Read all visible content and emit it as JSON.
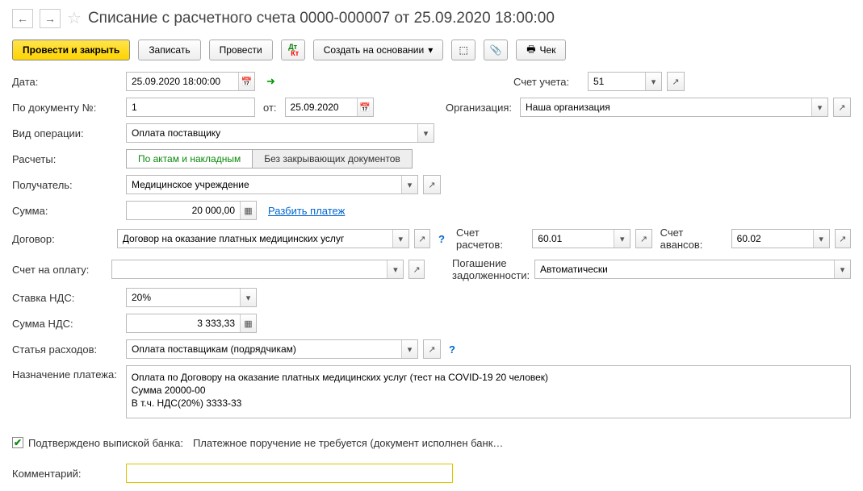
{
  "title": "Списание с расчетного счета 0000-000007 от 25.09.2020 18:00:00",
  "toolbar": {
    "post_close": "Провести и закрыть",
    "save": "Записать",
    "post": "Провести",
    "create_based": "Создать на основании",
    "check": "Чек"
  },
  "labels": {
    "date": "Дата:",
    "doc_no": "По документу №:",
    "from": "от:",
    "op_type": "Вид операции:",
    "calcs": "Расчеты:",
    "recipient": "Получатель:",
    "amount": "Сумма:",
    "split": "Разбить платеж",
    "contract": "Договор:",
    "invoice": "Счет на оплату:",
    "vat_rate": "Ставка НДС:",
    "vat_amount": "Сумма НДС:",
    "cost_item": "Статья расходов:",
    "purpose": "Назначение платежа:",
    "confirmed": "Подтверждено выпиской банка:",
    "confirmed_text": "Платежное поручение не требуется (документ исполнен банк…",
    "comment": "Комментарий:",
    "account": "Счет учета:",
    "org": "Организация:",
    "settle_acc": "Счет расчетов:",
    "advance_acc": "Счет авансов:",
    "debt": "Погашение задолженности:"
  },
  "toggles": {
    "by_acts": "По актам и накладным",
    "no_docs": "Без закрывающих документов"
  },
  "values": {
    "date": "25.09.2020 18:00:00",
    "doc_no": "1",
    "doc_date": "25.09.2020",
    "op_type": "Оплата поставщику",
    "recipient": "Медицинское учреждение",
    "amount": "20 000,00",
    "contract": "Договор на оказание платных медицинских услуг",
    "vat_rate": "20%",
    "vat_amount": "3 333,33",
    "cost_item": "Оплата поставщикам (подрядчикам)",
    "purpose": "Оплата по Договору на оказание платных медицинских услуг (тест на COVID-19 20 человек)\nСумма 20000-00\nВ т.ч. НДС(20%) 3333-33",
    "account": "51",
    "org": "Наша организация",
    "settle_acc": "60.01",
    "advance_acc": "60.02",
    "debt": "Автоматически",
    "comment": ""
  }
}
